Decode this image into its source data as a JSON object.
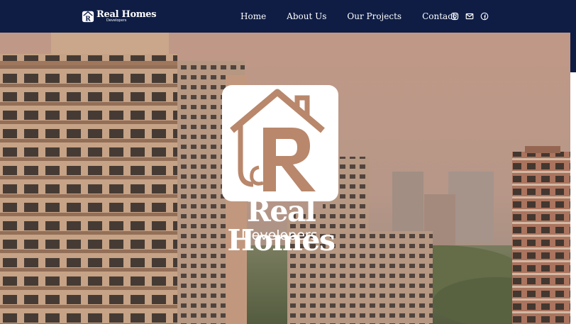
{
  "header": {
    "brand": {
      "name": "Real Homes",
      "sub": "Developers"
    },
    "nav": [
      {
        "label": "Home"
      },
      {
        "label": "About Us"
      },
      {
        "label": "Our Projects"
      },
      {
        "label": "Contact"
      }
    ],
    "socials": [
      "instagram-icon",
      "mail-icon",
      "facebook-icon"
    ]
  },
  "hero": {
    "logo_name": "Real Homes",
    "logo_sub": "Developers"
  },
  "colors": {
    "header_bg": "#0f1d45",
    "logo_tile": "#ffffff",
    "logo_accent": "#b9876b",
    "sky": "#c7a190"
  }
}
